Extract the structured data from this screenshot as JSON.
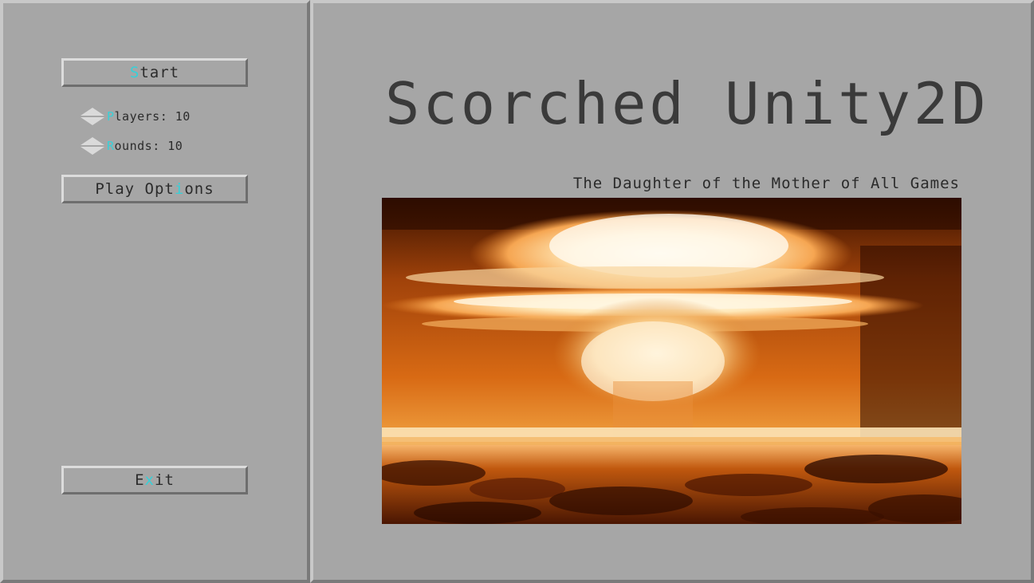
{
  "menu": {
    "start": {
      "hotkey": "S",
      "rest": "tart"
    },
    "players": {
      "hotkey": "P",
      "rest": "layers",
      "value": "10"
    },
    "rounds": {
      "hotkey": "R",
      "rest": "ounds",
      "value": "10"
    },
    "play_options": {
      "before": "Play Opt",
      "hotkey": "i",
      "after": "ons"
    },
    "exit": {
      "before": "E",
      "hotkey": "x",
      "after": "it"
    }
  },
  "title": "Scorched Unity2D",
  "subtitle": "The Daughter of the Mother of All Games",
  "image": {
    "subject": "nuclear mushroom cloud"
  },
  "colors": {
    "background": "#a6a6a6",
    "hotkey": "#38d0d8",
    "text": "#2b2b2b"
  }
}
